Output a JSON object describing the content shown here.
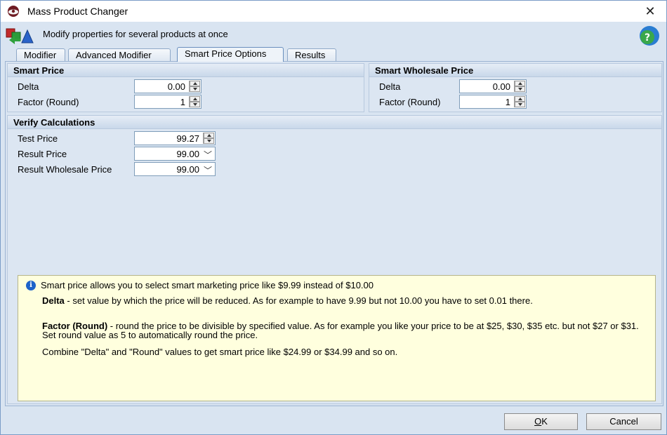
{
  "window": {
    "title": "Mass Product Changer",
    "close_symbol": "✕"
  },
  "header": {
    "text": "Modify properties for several products at once"
  },
  "tabs": [
    {
      "label": "Modifier",
      "active": false
    },
    {
      "label": "Advanced Modifier",
      "active": false
    },
    {
      "label": "Smart Price Options",
      "active": true
    },
    {
      "label": "Results",
      "active": false
    }
  ],
  "smart_price": {
    "title": "Smart Price",
    "delta_label": "Delta",
    "delta_value": "0.00",
    "factor_label": "Factor (Round)",
    "factor_value": "1"
  },
  "smart_wholesale": {
    "title": "Smart Wholesale Price",
    "delta_label": "Delta",
    "delta_value": "0.00",
    "factor_label": "Factor (Round)",
    "factor_value": "1"
  },
  "verify": {
    "title": "Verify Calculations",
    "test_price_label": "Test Price",
    "test_price_value": "99.27",
    "result_price_label": "Result Price",
    "result_price_value": "99.00",
    "result_wholesale_label": "Result Wholesale Price",
    "result_wholesale_value": "99.00"
  },
  "info": {
    "icon": "i",
    "headline": "Smart price allows you to select smart marketing price like $9.99 instead of $10.00",
    "delta_term": "Delta",
    "delta_text": " - set value by which the price will be reduced. As for example to have 9.99 but not 10.00 you have to set 0.01 there.",
    "factor_term": "Factor (Round)",
    "factor_text": " - round the price to be divisible by specified value. As for example you like your price to be at $25, $30, $35 etc. but not $27 or $31. Set round value as 5 to automatically round the price.",
    "combine_text": "Combine \"Delta\" and \"Round\" values to get smart price like $24.99 or $34.99 and so on."
  },
  "buttons": {
    "ok": "OK",
    "cancel": "Cancel"
  },
  "colors": {
    "window_bg": "#d9e4f1",
    "info_bg": "#ffffde",
    "info_icon": "#1e63c9"
  }
}
